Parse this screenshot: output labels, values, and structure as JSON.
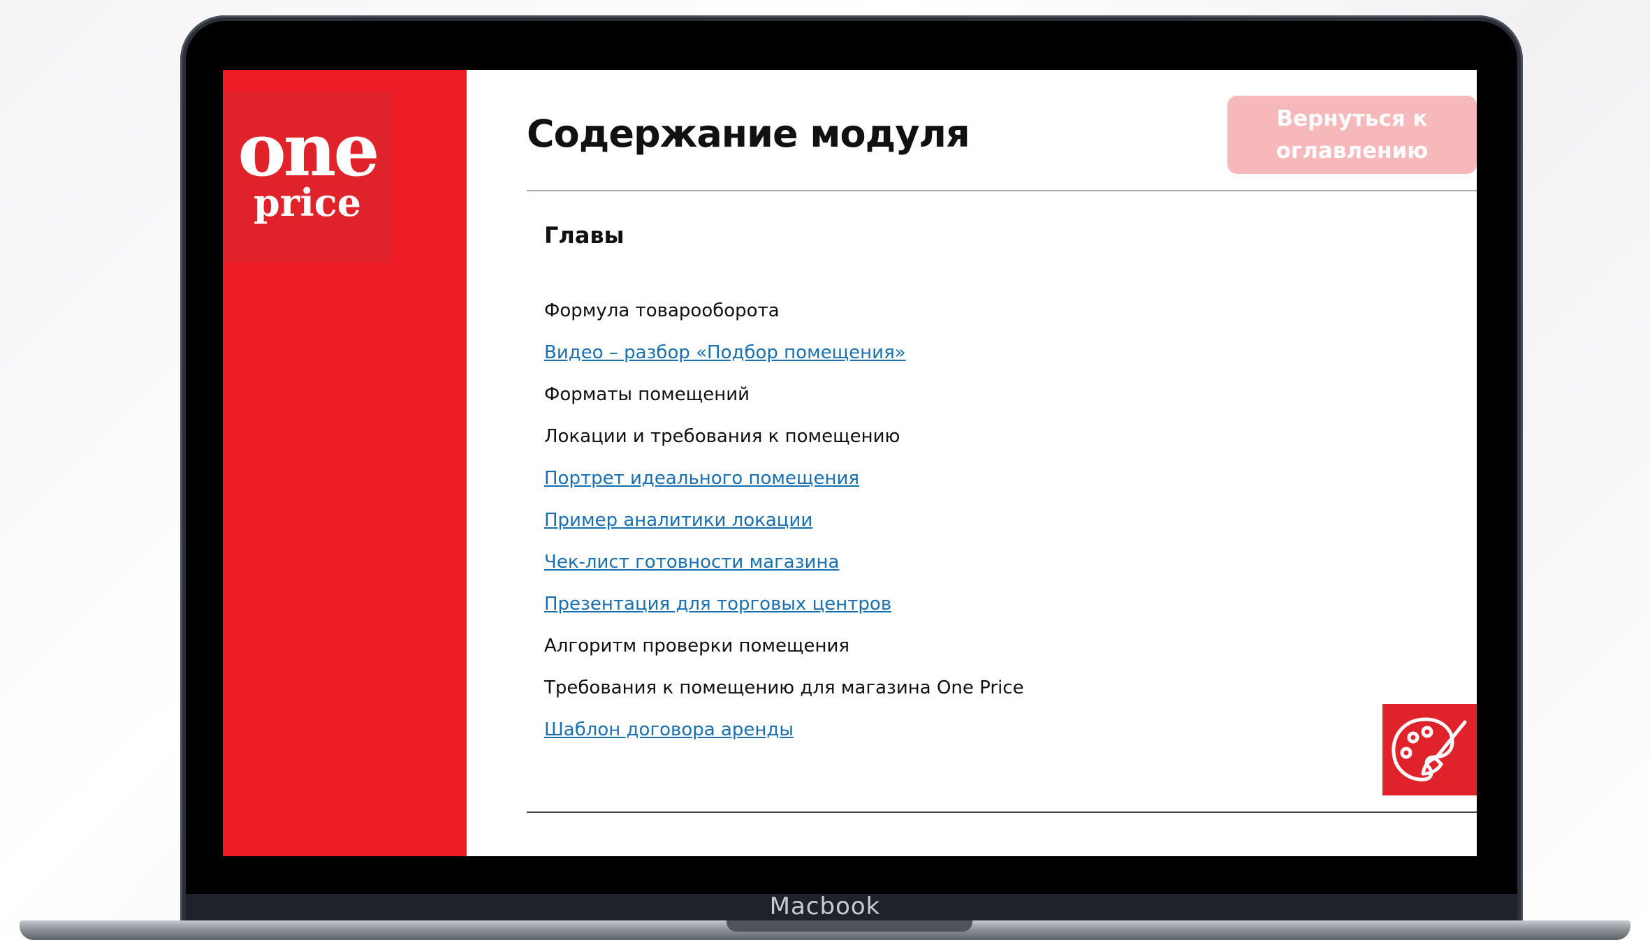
{
  "device": {
    "brand_label": "Macbook"
  },
  "logo": {
    "line1": "one",
    "line2": "price"
  },
  "header": {
    "title": "Содержание модуля",
    "back_button": "Вернуться к оглавлению"
  },
  "chapters": {
    "heading": "Главы",
    "items": [
      {
        "label": "Формула товарооборота",
        "is_link": false
      },
      {
        "label": "Видео – разбор «Подбор помещения»",
        "is_link": true
      },
      {
        "label": "Форматы помещений",
        "is_link": false
      },
      {
        "label": "Локации и требования к помещению",
        "is_link": false
      },
      {
        "label": "Портрет идеального помещения",
        "is_link": true
      },
      {
        "label": "Пример аналитики локации",
        "is_link": true
      },
      {
        "label": "Чек-лист готовности магазина",
        "is_link": true
      },
      {
        "label": "Презентация для торговых центров",
        "is_link": true
      },
      {
        "label": "Алгоритм проверки помещения",
        "is_link": false
      },
      {
        "label": "Требования к помещению для магазина One Price",
        "is_link": false
      },
      {
        "label": "Шаблон договора аренды",
        "is_link": true
      }
    ]
  },
  "floating_button": {
    "icon": "palette-icon"
  },
  "colors": {
    "sidebar": "#ee1c25",
    "link": "#1a6fb0",
    "back_button_bg": "#f6b8ba"
  }
}
